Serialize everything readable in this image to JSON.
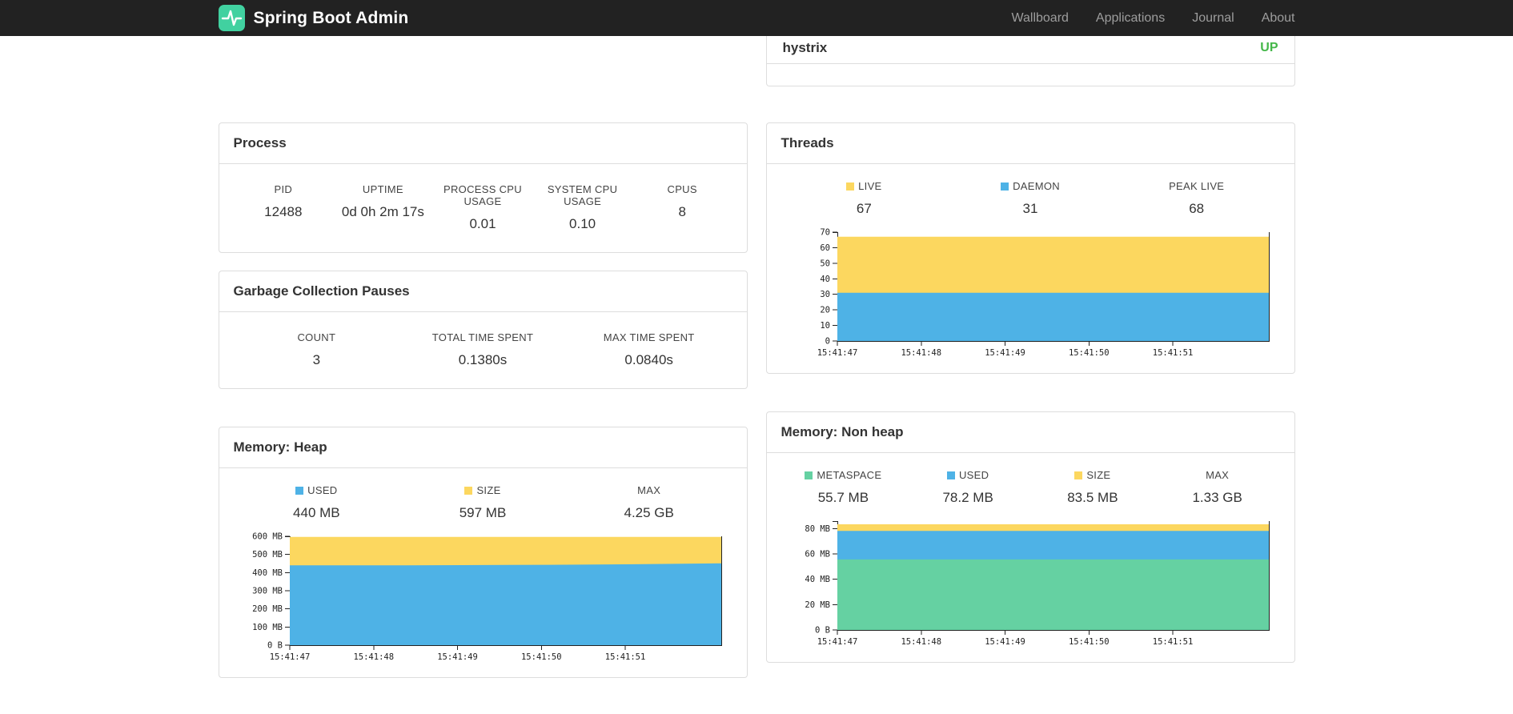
{
  "navbar": {
    "brand": "Spring Boot Admin",
    "items": [
      {
        "label": "Wallboard"
      },
      {
        "label": "Applications"
      },
      {
        "label": "Journal"
      },
      {
        "label": "About"
      }
    ]
  },
  "colors": {
    "navbar_bg": "#222222",
    "brand_green": "#41d1a0",
    "status_up": "#44b749",
    "series_yellow": "#fcd75f",
    "series_blue": "#4eb2e6",
    "series_green": "#65d1a2"
  },
  "status_panel": {
    "application": "hystrix",
    "status": "UP"
  },
  "panels": {
    "process": {
      "title": "Process",
      "stats": [
        {
          "label": "PID",
          "value": "12488"
        },
        {
          "label": "UPTIME",
          "value": "0d 0h 2m 17s"
        },
        {
          "label": "PROCESS CPU USAGE",
          "value": "0.01"
        },
        {
          "label": "SYSTEM CPU USAGE",
          "value": "0.10"
        },
        {
          "label": "CPUS",
          "value": "8"
        }
      ]
    },
    "gc": {
      "title": "Garbage Collection Pauses",
      "stats": [
        {
          "label": "COUNT",
          "value": "3"
        },
        {
          "label": "TOTAL TIME SPENT",
          "value": "0.1380s"
        },
        {
          "label": "MAX TIME SPENT",
          "value": "0.0840s"
        }
      ]
    },
    "threads": {
      "title": "Threads",
      "stats": [
        {
          "label": "LIVE",
          "value": "67"
        },
        {
          "label": "DAEMON",
          "value": "31"
        },
        {
          "label": "PEAK LIVE",
          "value": "68"
        }
      ]
    },
    "heap": {
      "title": "Memory: Heap",
      "stats": [
        {
          "label": "USED",
          "value": "440 MB"
        },
        {
          "label": "SIZE",
          "value": "597 MB"
        },
        {
          "label": "MAX",
          "value": "4.25 GB"
        }
      ]
    },
    "nonheap": {
      "title": "Memory: Non heap",
      "stats": [
        {
          "label": "METASPACE",
          "value": "55.7 MB"
        },
        {
          "label": "USED",
          "value": "78.2 MB"
        },
        {
          "label": "SIZE",
          "value": "83.5 MB"
        },
        {
          "label": "MAX",
          "value": "1.33 GB"
        }
      ]
    }
  },
  "chart_data": [
    {
      "id": "threads",
      "type": "area",
      "stacked": true,
      "title": "Threads",
      "note": "series ordered top-first; values are stacked cumulative tops",
      "x": [
        "15:41:47",
        "15:41:48",
        "15:41:49",
        "15:41:50",
        "15:41:51"
      ],
      "ylim": [
        0,
        70
      ],
      "yticks": [
        {
          "v": 0,
          "label": "0"
        },
        {
          "v": 10,
          "label": "10"
        },
        {
          "v": 20,
          "label": "20"
        },
        {
          "v": 30,
          "label": "30"
        },
        {
          "v": 40,
          "label": "40"
        },
        {
          "v": 50,
          "label": "50"
        },
        {
          "v": 60,
          "label": "60"
        },
        {
          "v": 70,
          "label": "70"
        }
      ],
      "series": [
        {
          "name": "LIVE",
          "color": "#fcd75f",
          "values": [
            67,
            67,
            67,
            67,
            67,
            67
          ]
        },
        {
          "name": "DAEMON",
          "color": "#4eb2e6",
          "values": [
            31,
            31,
            31,
            31,
            31,
            31
          ]
        }
      ],
      "legend_position": "top",
      "grid": false
    },
    {
      "id": "heap",
      "type": "area",
      "stacked": true,
      "title": "Memory: Heap",
      "note": "series ordered top-first; values in MB; stacked cumulative tops",
      "x": [
        "15:41:47",
        "15:41:48",
        "15:41:49",
        "15:41:50",
        "15:41:51"
      ],
      "ylim": [
        0,
        600
      ],
      "yticks": [
        {
          "v": 0,
          "label": "0 B"
        },
        {
          "v": 100,
          "label": "100 MB"
        },
        {
          "v": 200,
          "label": "200 MB"
        },
        {
          "v": 300,
          "label": "300 MB"
        },
        {
          "v": 400,
          "label": "400 MB"
        },
        {
          "v": 500,
          "label": "500 MB"
        },
        {
          "v": 600,
          "label": "600 MB"
        }
      ],
      "series": [
        {
          "name": "SIZE",
          "color": "#fcd75f",
          "values": [
            597,
            597,
            597,
            597,
            597,
            597
          ]
        },
        {
          "name": "USED",
          "color": "#4eb2e6",
          "values": [
            440,
            440,
            441,
            443,
            446,
            451
          ]
        }
      ],
      "legend_position": "top",
      "grid": false
    },
    {
      "id": "nonheap",
      "type": "area",
      "stacked": true,
      "title": "Memory: Non heap",
      "note": "series ordered top-first; values in MB; stacked cumulative tops",
      "x": [
        "15:41:47",
        "15:41:48",
        "15:41:49",
        "15:41:50",
        "15:41:51"
      ],
      "ylim": [
        0,
        86
      ],
      "yticks": [
        {
          "v": 0,
          "label": "0 B"
        },
        {
          "v": 20,
          "label": "20 MB"
        },
        {
          "v": 40,
          "label": "40 MB"
        },
        {
          "v": 60,
          "label": "60 MB"
        },
        {
          "v": 80,
          "label": "80 MB"
        }
      ],
      "series": [
        {
          "name": "SIZE",
          "color": "#fcd75f",
          "values": [
            83.5,
            83.5,
            83.5,
            83.5,
            83.5,
            83.5
          ]
        },
        {
          "name": "USED",
          "color": "#4eb2e6",
          "values": [
            78.2,
            78.2,
            78.2,
            78.2,
            78.2,
            78.2
          ]
        },
        {
          "name": "METASPACE",
          "color": "#65d1a2",
          "values": [
            55.7,
            55.7,
            55.7,
            55.7,
            55.7,
            55.7
          ]
        }
      ],
      "legend_position": "top",
      "grid": false
    }
  ]
}
